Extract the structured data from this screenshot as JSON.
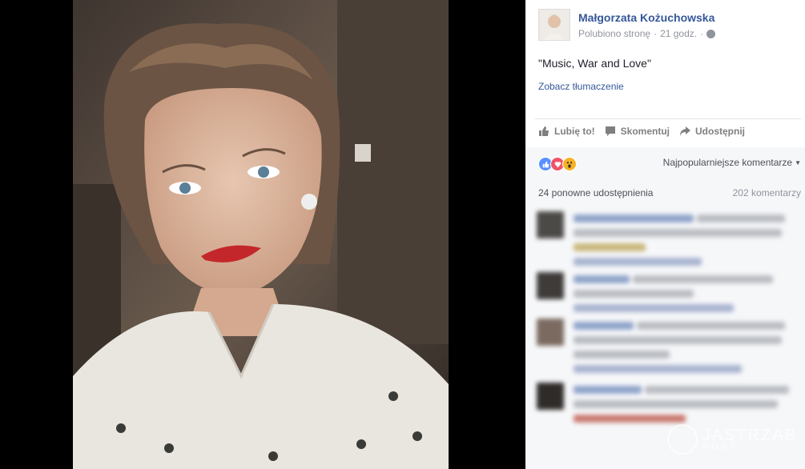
{
  "post": {
    "author": "Małgorzata Kożuchowska",
    "liked_label": "Polubiono stronę",
    "separator": "·",
    "time": "21 godz.",
    "separator2": "·",
    "caption": "\"Music, War and Love\"",
    "translate_link": "Zobacz tłumaczenie"
  },
  "actions": {
    "like": "Lubię to!",
    "comment": "Skomentuj",
    "share": "Udostępnij"
  },
  "reactions": {
    "icons": [
      "like-icon",
      "love-icon",
      "wow-icon"
    ],
    "colors": {
      "like": "#5890ff",
      "love": "#f25268",
      "wow": "#f7b125"
    }
  },
  "comments": {
    "sort_label": "Najpopularniejsze komentarze",
    "shares": "24 ponowne udostępnienia",
    "count": "202 komentarzy"
  },
  "watermark": {
    "text": "JASTRZAB",
    "subtext": "POST"
  },
  "colors": {
    "link": "#365899",
    "panel_bg": "#ffffff",
    "comments_bg": "#f6f7f9",
    "backdrop": "#000000"
  }
}
